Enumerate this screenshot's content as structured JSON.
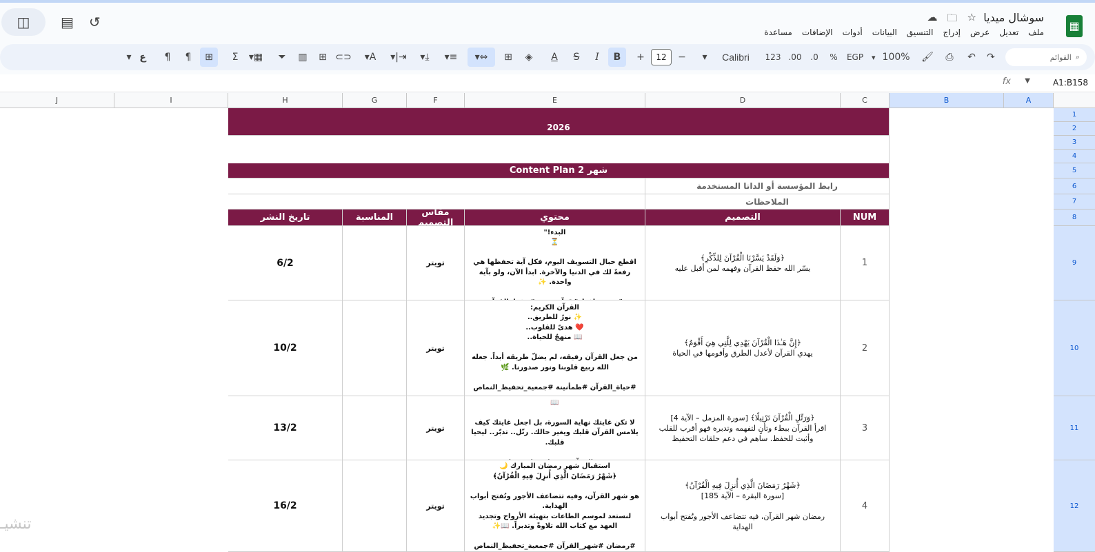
{
  "app": {
    "doc_title": "سوشال ميديا",
    "menus": [
      "ملف",
      "تعديل",
      "عرض",
      "إدراج",
      "التنسيق",
      "البيانات",
      "أدوات",
      "الإضافات",
      "مساعدة"
    ]
  },
  "toolbar": {
    "search_placeholder": "القوائم",
    "zoom": "100%",
    "currency": "EGP",
    "percent": "%",
    "dec_less": ".0",
    "dec_more": ".00",
    "num_format": "123",
    "font": "Calibri",
    "font_size": "12",
    "minus": "−",
    "plus": "+",
    "bold": "B",
    "italic": "I",
    "strike": "S",
    "text_color": "A",
    "sigma": "Σ",
    "direction_ltr": "¶",
    "direction_rtl": "¶",
    "functions_label": "ع"
  },
  "formula_bar": {
    "name_box": "A1:B158",
    "fx": "fx"
  },
  "columns": [
    {
      "id": "A",
      "label": "A"
    },
    {
      "id": "B",
      "label": "B"
    },
    {
      "id": "C",
      "label": "C"
    },
    {
      "id": "D",
      "label": "D"
    },
    {
      "id": "E",
      "label": "E"
    },
    {
      "id": "F",
      "label": "F"
    },
    {
      "id": "G",
      "label": "G"
    },
    {
      "id": "H",
      "label": "H"
    },
    {
      "id": "I",
      "label": "I"
    },
    {
      "id": "J",
      "label": "J"
    }
  ],
  "rows": [
    "1",
    "2",
    "3",
    "4",
    "5",
    "6",
    "7",
    "8",
    "9",
    "10",
    "11",
    "12"
  ],
  "sheet": {
    "year": "2026",
    "plan_title": "شهر 2  Content Plan",
    "org_link_label": "رابط المؤسسة أو الداتا المستخدمة",
    "notes_label": "الملاحظات",
    "headers": {
      "num": "NUM",
      "design": "التصميم",
      "content": "محتوي",
      "size": "مقاس التصميم",
      "occasion": "المناسبة",
      "date": "تاريخ النشر"
    },
    "entries": [
      {
        "num": "1",
        "design": "﴿وَلَقَدْ يَسَّرْنَا الْقُرْآنَ لِلذِّكْرِ﴾\nيسّر الله حفظ القرآن وفهمه لمن أقبل عليه",
        "content": "\"حفظ القرآن ليس صعباً.. الصعبُ حقاً هو أن نؤجل البدء!\"\n⏳\n\nاقطع حبال التسويف اليوم، فكل آية تحفظها هي رفعةٌ لك في الدنيا والآخرة. ابدأ الآن، ولو بآية واحدة. ✨\n\n#همة_حافظ #قرآني_نور #حفظ_القرآن",
        "size": "تويتر",
        "occasion": "",
        "date": "6/2"
      },
      {
        "num": "2",
        "design": "﴿إِنَّ هَـٰذَا الْقُرْآنَ يَهْدِي لِلَّتِي هِيَ أَقْوَمُ﴾\nيهدي القرآن لأعدل الطرق وأقومها في الحياة",
        "content": "القرآن الكريم:\n✨ نورٌ للطريق..\n❤️ هدىً للقلوب..\n📖 منهجٌ للحياة..\n\nمن جعل القرآن رفيقه، لم يضلّ طريقه أبداً. جعله الله ربيع قلوبنا ونور صدورنا. 🌿\n\n#حياة_القرآن #طمأنينة #جمعية_تحفيظ_النماص",
        "size": "تويتر",
        "occasion": "",
        "date": "10/2"
      },
      {
        "num": "3",
        "design": "﴿وَرَتِّلِ الْقُرْآنَ تَرْتِيلًا﴾ [سورة المزمل – الآية 4]\nاقرأ القرآن ببطء وتأنٍ لتفهمه وتدبره فهو أقرب للقلب وأثبت للحفظ.    ساهم في دعم حلقات التحفيظ",
        "content": "\"الترتيل مفتاح التدبر.. ومع التدبر تحيا القلوب.\" ❤️ 📖\n\nلا تكن غايتك نهاية السورة، بل اجعل غايتك كيف يلامس القرآن قلبك ويغير حالك. رتّل.. تدبّر.. ليحيا قلبك.\n\n#تدبر_القرآن #ترتيل #تلاوة_خاشعة",
        "size": "تويتر",
        "occasion": "",
        "date": "13/2"
      },
      {
        "num": "4",
        "design": "﴿شَهْرُ رَمَضَانَ الَّذِي أُنزِلَ فِيهِ الْقُرْآنُ﴾\n[سورة البقرة – الآية 185]\n\nرمضان شهر القرآن، فيه تتضاعف الأجور وتُفتح أبواب الهداية",
        "content": "استقبال شهر رمضان المبارك 🌙\n﴿شَهْرُ رَمَضَانَ الَّذِي أُنزِلَ فِيهِ الْقُرْآنُ﴾\n\nهو شهر القرآن، وفيه تتضاعف الأجور وتُفتح أبواب الهداية.\nلنستعد لموسم الطاعات بتهيئة الأرواح وتجديد العهد مع كتاب الله تلاوةً وتدبراً. 📖✨\n\n#رمضان #شهر_القرآن #جمعية_تحفيظ_النماص",
        "size": "تويتر",
        "occasion": "",
        "date": "16/2"
      }
    ]
  },
  "watermark": "تنشيـ"
}
